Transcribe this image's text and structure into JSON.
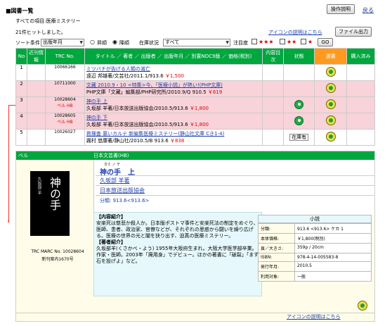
{
  "header": {
    "title": "■図書一覧",
    "help_button": "操作説明",
    "back_link": "戻る",
    "search_items": "すべての項目:医療ミステリー",
    "result_count": "21件ヒットしました。",
    "icon_link": "アイコンの説明はこちら",
    "file_output": "ファイル出力"
  },
  "sort_bar": {
    "sort_label": "ソート条件",
    "sort_value": "出版年月",
    "asc_label": "昇順",
    "desc_label": "降順",
    "stock_label": "在庫状況",
    "stock_value": "すべて",
    "attention_label": "注目度",
    "go_button": "GO",
    "stars3": "★★★",
    "stars2": "★★",
    "stars1": "★"
  },
  "table": {
    "headers": {
      "no": "No",
      "recent": "近刊情報",
      "trc": "TRC No.",
      "info": "タイトル ／ 著者 ／ 出版者 ／ 出版年月 ／ 別置NDC9版 ／ 価格(税別)",
      "contents": "内容目次",
      "status": "状態",
      "select": "選書",
      "purchased": "購入済み"
    },
    "rows": [
      {
        "no": "1",
        "trc": "10066166",
        "badge": "",
        "title": "ミツバチが告げる人類の滅亡",
        "meta": "遠辺 邦雄著/文芸社/2011.1/913.6",
        "price": "￥1,500",
        "status": "",
        "color": "white"
      },
      {
        "no": "2",
        "trc": "10711000",
        "badge": "",
        "title": "文藏 2010.9・10 <特集>今、「医療小説」が熱い!(PHP文庫)",
        "meta": "PHP文庫「文藏」編集部/PHP研究所/2010.9/Q 910.5",
        "price": "￥619",
        "status": "",
        "color": "pink"
      },
      {
        "no": "3",
        "trc": "10028604",
        "badge": "ベル HB",
        "title": "神の手 上",
        "meta": "久坂部 羊著/日本放送出版協会/2010.5/913.6",
        "price": "￥1,800",
        "status": "circle",
        "color": "pink"
      },
      {
        "no": "4",
        "trc": "10028605",
        "badge": "ベル HB",
        "title": "神の手 下",
        "meta": "久坂部 羊著/日本放送出版協会/2010.5/913.6",
        "price": "￥1,800",
        "status": "circle",
        "color": "pink"
      },
      {
        "no": "5",
        "trc": "10026027",
        "badge": "",
        "title": "救捜査 悪いカルテ 新編集医療ミステリー(静山社文庫 Cき1-4)",
        "meta": "霧村 悠康著/静山社/2010.5/B 913.6",
        "price": "￥838",
        "status": "在庫有",
        "color": "white"
      }
    ]
  },
  "detail": {
    "publisher_label": "ベル",
    "series": "日本文芸書(HB)",
    "kana": "カミ ノ テ",
    "title": "神の手　上",
    "author": "久坂部 羊著",
    "publisher": "日本放送出版協会",
    "class": "分類: 913.6<913.6>",
    "cover_title": "神の手",
    "cover_author": "久坂部 羊",
    "marc": "TRC MARC No. 10028604",
    "issue": "新刊案内1670号",
    "content_head": "【内容紹介】",
    "content_body": "安楽死は慈悲か殺人か。日本版ポストマ事件と安楽死法の制定をめぐり、医師、患者、政治家、官僚などが、それぞれの思惑から闘いを繰り広げる。医療の世界の光と闇を抉り出す、迫真の医療ミステリー。",
    "author_head": "【著者紹介】",
    "author_body": "久坂部羊(くさかべ・よう) 1955年大阪府生まれ。大阪大学医学部卒業。作家・医師。2003年「廃用身」でデビュー。ほかの著書に「破裂」「まず石を投げよ」など。",
    "genre": "小説",
    "specs": [
      {
        "k": "分類:",
        "v": "913.6 <913.6>  ケカ 1"
      },
      {
        "k": "本体価格:",
        "v": "￥1,800(税別)"
      },
      {
        "k": "頁／大きさ:",
        "v": "359p / 20cm"
      },
      {
        "k": "ISBN:",
        "v": "978-4-14-005583-8"
      },
      {
        "k": "発行年月:",
        "v": "2010.5"
      },
      {
        "k": "利用対象:",
        "v": "一般"
      }
    ],
    "icon_link": "アイコンの説明はこちら"
  }
}
